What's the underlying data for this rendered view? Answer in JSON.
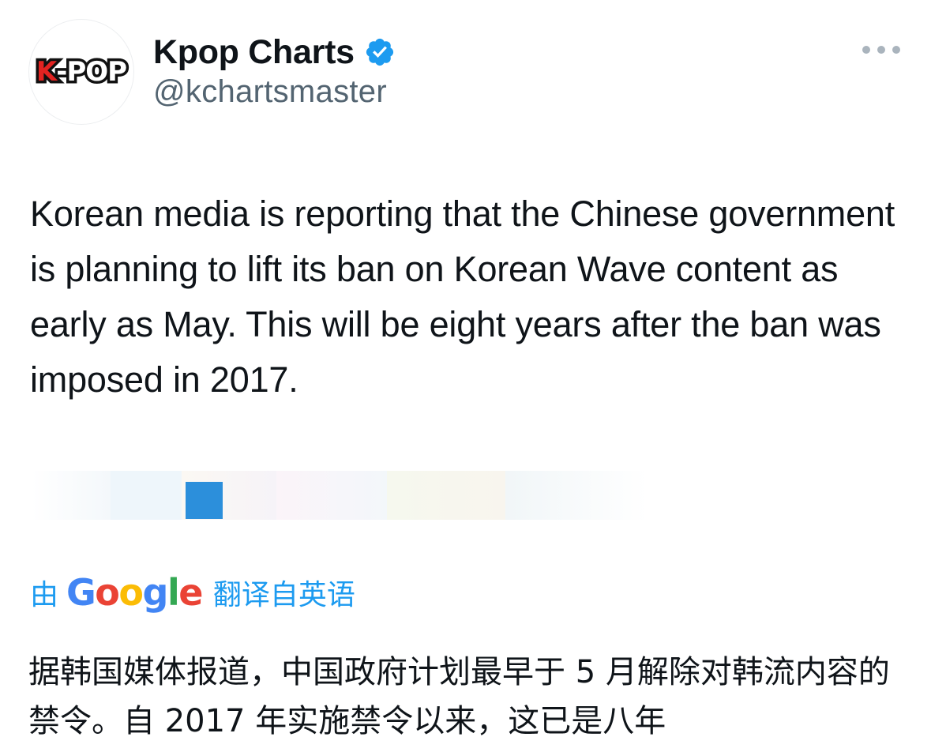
{
  "account": {
    "avatar_text_k": "K",
    "avatar_text_rest": "-POP",
    "display_name": "Kpop Charts",
    "handle": "@kchartsmaster",
    "verified_icon": "verified-badge-icon",
    "more_icon": "more-dots-icon"
  },
  "tweet": {
    "text": "Korean media is reporting that the Chinese government is planning to lift its ban on Korean Wave content as early as May. This will be eight years after the ban was imposed in 2017."
  },
  "translation": {
    "prefix": "由",
    "google": [
      "G",
      "o",
      "o",
      "g",
      "l",
      "e"
    ],
    "suffix": "翻译自英语",
    "text": "据韩国媒体报道，中国政府计划最早于 5 月解除对韩流内容的禁令。自 2017 年实施禁令以来，这已是八年"
  },
  "colors": {
    "accent": "#1d9bf0",
    "handle": "#536471",
    "text": "#0f1419",
    "logo_red": "#e32321"
  }
}
